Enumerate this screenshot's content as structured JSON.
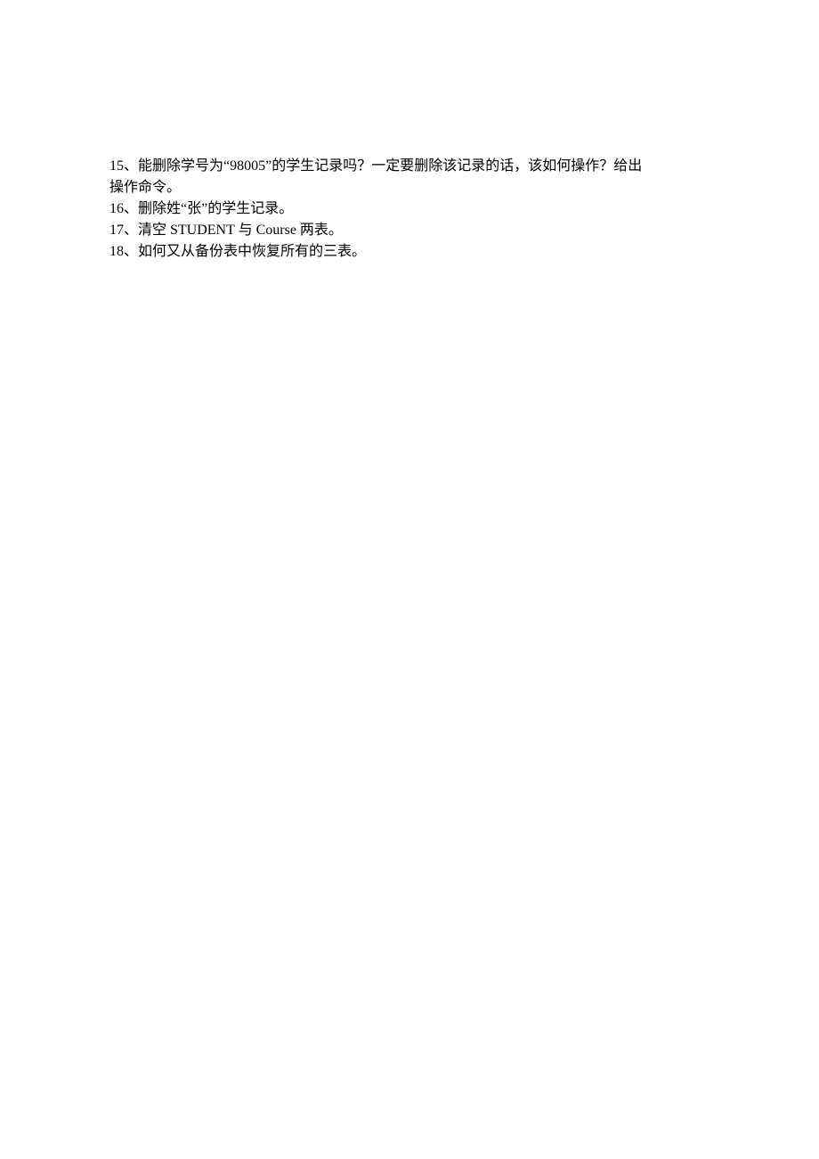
{
  "questions": {
    "q15_line1": "15、能删除学号为“98005”的学生记录吗？一定要删除该记录的话，该如何操作？给出",
    "q15_line2": "操作命令。",
    "q16": "16、删除姓“张”的学生记录。",
    "q17": "17、清空 STUDENT 与 Course 两表。",
    "q18": "18、如何又从备份表中恢复所有的三表。"
  }
}
